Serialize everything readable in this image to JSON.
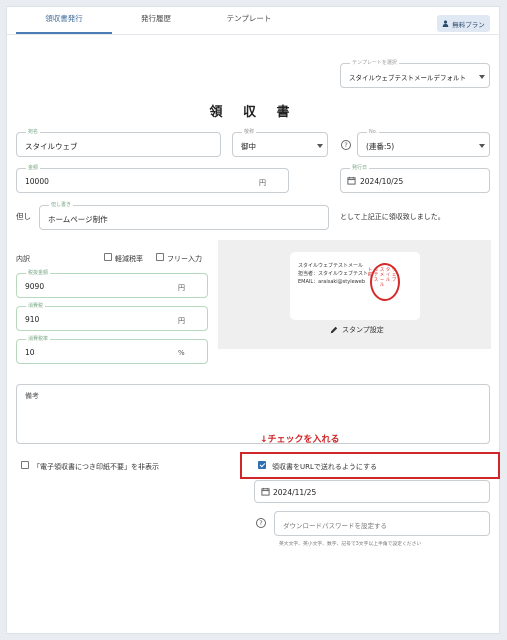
{
  "tabs": [
    {
      "label": "領収書発行",
      "active": true
    },
    {
      "label": "発行履歴",
      "active": false
    },
    {
      "label": "テンプレート",
      "active": false
    }
  ],
  "plan_button": {
    "label": "無料プラン",
    "icon": "user-icon"
  },
  "template_select": {
    "label": "テンプレートを選択",
    "value": "スタイルウェブテストメールデフォルト"
  },
  "doc_title": "領 収 書",
  "recipient": {
    "label": "宛名",
    "value": "スタイルウェブ"
  },
  "honorific": {
    "label": "敬称",
    "value": "御中"
  },
  "number": {
    "label": "No.",
    "value": "(連番:5)"
  },
  "amount": {
    "label": "金額",
    "value": "10000",
    "unit": "円"
  },
  "issue_date": {
    "label": "発行日",
    "value": "2024/10/25"
  },
  "proviso": {
    "prefix": "但し",
    "label": "但し書き",
    "value": "ホームページ制作",
    "suffix": "として上記正に領収致しました。"
  },
  "breakdown": {
    "label": "内訳",
    "reduced_tax": {
      "label": "軽減税率",
      "checked": false
    },
    "free_input": {
      "label": "フリー入力",
      "checked": false
    },
    "pre_tax": {
      "label": "税抜金額",
      "value": "9090",
      "unit": "円"
    },
    "tax": {
      "label": "消費税",
      "value": "910",
      "unit": "円"
    },
    "tax_rate": {
      "label": "消費税率",
      "value": "10",
      "unit": "%"
    }
  },
  "preview": {
    "company": "スタイルウェブテストメール",
    "person": "担当者：スタイルウェブテストメー",
    "email": "EMAIL：araisaki@styleweb",
    "stamp_cols": [
      "ウェブ",
      "タイル",
      "スメール",
      "ルテス",
      "ト印"
    ],
    "stamp_button": "スタンプ設定"
  },
  "memo": {
    "label": "備考",
    "value": ""
  },
  "annotation": "↓チェックを入れる",
  "hide_stamp_notice": {
    "label": "「電子領収書につき印紙不要」を非表示",
    "checked": false
  },
  "send_by_url": {
    "label": "領収書をURLで送れるようにする",
    "checked": true
  },
  "url_date": {
    "value": "2024/11/25"
  },
  "download_password": {
    "placeholder": "ダウンロードパスワードを設定する",
    "hint": "英大文字、英小文字、数字、記号で3文字以上半角で設定ください"
  },
  "colors": {
    "accent": "#2f6fb0",
    "annotation": "#d0262a",
    "stamp": "#d42a2a"
  }
}
